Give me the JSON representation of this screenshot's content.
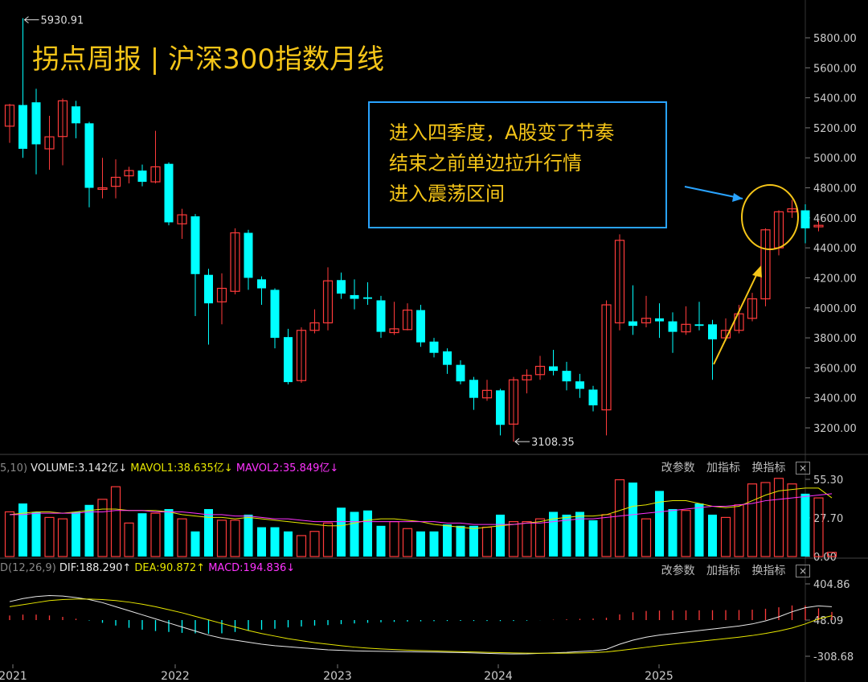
{
  "title": "拐点周报 | 沪深300指数月线",
  "annotation_lines": [
    "进入四季度，A股变了节奏",
    "结束之前单边拉升行情",
    "进入震荡区间"
  ],
  "colors": {
    "up": "#ff3b3b",
    "down": "#00ffff",
    "accent": "#f5c518",
    "box": "#29a3ff",
    "ma1": "#e6e600",
    "ma2": "#ff33ff",
    "dif": "#e8e8e8"
  },
  "buttons": {
    "params": "改参数",
    "add": "加指标",
    "change": "换指标",
    "close": "×"
  },
  "volume_legend": {
    "prefix": "5,10)",
    "volume": "VOLUME:3.142亿↓",
    "mavol1": "MAVOL1:38.635亿↓",
    "mavol2": "MAVOL2:35.849亿↓"
  },
  "macd_legend": {
    "prefix": "D(12,26,9)",
    "dif": "DIF:188.290↑",
    "dea": "DEA:90.872↑",
    "macd": "MACD:194.836↓"
  },
  "chart_data": [
    {
      "type": "candlestick",
      "ylim": [
        3108.35,
        5930.91
      ],
      "y_ticks": [
        "5800.00",
        "5600.00",
        "5400.00",
        "5200.00",
        "5000.00",
        "4800.00",
        "4600.00",
        "4400.00",
        "4200.00",
        "4000.00",
        "3800.00",
        "3600.00",
        "3400.00",
        "3200.00"
      ],
      "x_ticks": [
        "2021",
        "2022",
        "2023",
        "2024",
        "2025"
      ],
      "high_label": "5930.91",
      "low_label": "3108.35",
      "candles": [
        [
          5211,
          5351,
          5360,
          5100
        ],
        [
          5352,
          5060,
          5930.91,
          5000
        ],
        [
          5370,
          5090,
          5460,
          4890
        ],
        [
          5060,
          5140,
          5280,
          4920
        ],
        [
          5142,
          5380,
          5395,
          4950
        ],
        [
          5343,
          5230,
          5380,
          5130
        ],
        [
          5230,
          4800,
          5240,
          4670
        ],
        [
          4790,
          4800,
          5000,
          4730
        ],
        [
          4810,
          4870,
          4990,
          4730
        ],
        [
          4880,
          4915,
          4940,
          4830
        ],
        [
          4915,
          4840,
          4955,
          4810
        ],
        [
          4840,
          4940,
          5180,
          4830
        ],
        [
          4960,
          4570,
          4970,
          4550
        ],
        [
          4560,
          4620,
          4660,
          4460
        ],
        [
          4610,
          4225,
          4625,
          3945
        ],
        [
          4220,
          4030,
          4260,
          3755
        ],
        [
          4040,
          4130,
          4230,
          3890
        ],
        [
          4110,
          4500,
          4530,
          4090
        ],
        [
          4500,
          4200,
          4520,
          4120
        ],
        [
          4190,
          4130,
          4210,
          4020
        ],
        [
          4120,
          3800,
          4130,
          3730
        ],
        [
          3805,
          3505,
          3860,
          3490
        ],
        [
          3515,
          3850,
          3870,
          3500
        ],
        [
          3850,
          3900,
          3990,
          3830
        ],
        [
          3900,
          4180,
          4270,
          3850
        ],
        [
          4185,
          4095,
          4235,
          4060
        ],
        [
          4085,
          4060,
          4190,
          3990
        ],
        [
          4070,
          4060,
          4170,
          4020
        ],
        [
          4050,
          3840,
          4080,
          3800
        ],
        [
          3835,
          3860,
          4040,
          3820
        ],
        [
          3855,
          3985,
          4030,
          3850
        ],
        [
          3985,
          3770,
          4020,
          3740
        ],
        [
          3775,
          3700,
          3800,
          3670
        ],
        [
          3710,
          3620,
          3730,
          3560
        ],
        [
          3620,
          3510,
          3650,
          3490
        ],
        [
          3520,
          3400,
          3540,
          3320
        ],
        [
          3400,
          3450,
          3520,
          3380
        ],
        [
          3450,
          3220,
          3460,
          3150
        ],
        [
          3225,
          3520,
          3540,
          3108.35
        ],
        [
          3520,
          3550,
          3590,
          3430
        ],
        [
          3555,
          3610,
          3680,
          3520
        ],
        [
          3610,
          3580,
          3720,
          3550
        ],
        [
          3580,
          3510,
          3640,
          3450
        ],
        [
          3510,
          3460,
          3560,
          3400
        ],
        [
          3455,
          3350,
          3480,
          3310
        ],
        [
          3320,
          4020,
          4050,
          3150
        ],
        [
          3900,
          4450,
          4490,
          3850
        ],
        [
          3910,
          3880,
          4150,
          3820
        ],
        [
          3900,
          3930,
          4080,
          3870
        ],
        [
          3930,
          3910,
          4030,
          3800
        ],
        [
          3910,
          3840,
          3970,
          3700
        ],
        [
          3840,
          3890,
          4010,
          3820
        ],
        [
          3890,
          3880,
          4040,
          3850
        ],
        [
          3890,
          3790,
          3920,
          3520
        ],
        [
          3800,
          3850,
          3930,
          3780
        ],
        [
          3850,
          3960,
          4020,
          3830
        ],
        [
          3930,
          4060,
          4100,
          3910
        ],
        [
          4060,
          4520,
          4530,
          4010
        ],
        [
          4400,
          4640,
          4650,
          4350
        ],
        [
          4640,
          4660,
          4720,
          4600
        ],
        [
          4650,
          4530,
          4690,
          4430
        ],
        [
          4540,
          4550,
          4580,
          4510
        ]
      ]
    },
    {
      "type": "bar",
      "name": "volume",
      "y_ticks": [
        "55.30",
        "27.70",
        "0.00"
      ],
      "ylim": [
        0,
        55.3
      ],
      "values": [
        32,
        38,
        32,
        28,
        27,
        32,
        37,
        41,
        50,
        24,
        31,
        31,
        34,
        27,
        18,
        34,
        26,
        26,
        30,
        21,
        21,
        18,
        15,
        18,
        24,
        35,
        32,
        33,
        22,
        25,
        20,
        18,
        18,
        23,
        22,
        22,
        21,
        30,
        25,
        25,
        27,
        32,
        30,
        32,
        26,
        30,
        55,
        53,
        27,
        47,
        34,
        33,
        38,
        30,
        28,
        37,
        52,
        53,
        56,
        52,
        45,
        42,
        3
      ],
      "mavol1": [
        30,
        31,
        32,
        32,
        31,
        32,
        33,
        34,
        34,
        33,
        33,
        33,
        32,
        30,
        29,
        28,
        28,
        27,
        28,
        27,
        26,
        25,
        24,
        23,
        22,
        22,
        24,
        26,
        27,
        27,
        26,
        25,
        23,
        22,
        21,
        20,
        21,
        22,
        23,
        24,
        25,
        27,
        28,
        29,
        29,
        30,
        33,
        36,
        37,
        39,
        40,
        40,
        38,
        36,
        35,
        36,
        40,
        44,
        47,
        48,
        49,
        49,
        42
      ],
      "mavol2": [
        30,
        30,
        31,
        31,
        31,
        31,
        32,
        32,
        33,
        33,
        33,
        32,
        32,
        32,
        31,
        30,
        30,
        29,
        29,
        28,
        27,
        27,
        26,
        25,
        25,
        25,
        25,
        25,
        25,
        25,
        25,
        25,
        25,
        24,
        24,
        23,
        23,
        23,
        23,
        24,
        24,
        25,
        26,
        27,
        27,
        28,
        29,
        30,
        31,
        32,
        33,
        34,
        35,
        36,
        36,
        37,
        38,
        40,
        41,
        42,
        43,
        44,
        45
      ]
    },
    {
      "type": "macd",
      "y_ticks": [
        "404.86",
        "48.09",
        "-308.68"
      ],
      "ylim": [
        -308.68,
        404.86
      ],
      "dif": [
        230,
        260,
        280,
        290,
        285,
        270,
        250,
        220,
        180,
        140,
        100,
        60,
        20,
        -20,
        -60,
        -100,
        -130,
        -150,
        -170,
        -190,
        -205,
        -215,
        -225,
        -235,
        -245,
        -250,
        -255,
        -258,
        -260,
        -262,
        -264,
        -266,
        -268,
        -270,
        -272,
        -276,
        -280,
        -284,
        -286,
        -285,
        -280,
        -275,
        -270,
        -262,
        -255,
        -240,
        -190,
        -150,
        -120,
        -100,
        -85,
        -70,
        -55,
        -40,
        -25,
        -10,
        10,
        40,
        80,
        130,
        170,
        188.29,
        180
      ],
      "dea": [
        180,
        200,
        220,
        240,
        250,
        255,
        255,
        250,
        240,
        225,
        205,
        180,
        150,
        120,
        85,
        50,
        15,
        -20,
        -55,
        -85,
        -110,
        -135,
        -155,
        -175,
        -190,
        -205,
        -218,
        -228,
        -236,
        -242,
        -248,
        -252,
        -256,
        -260,
        -263,
        -266,
        -270,
        -273,
        -276,
        -278,
        -279,
        -279,
        -278,
        -276,
        -272,
        -266,
        -252,
        -236,
        -220,
        -204,
        -190,
        -176,
        -162,
        -148,
        -134,
        -120,
        -104,
        -84,
        -60,
        -30,
        10,
        60,
        90.872
      ]
    }
  ]
}
